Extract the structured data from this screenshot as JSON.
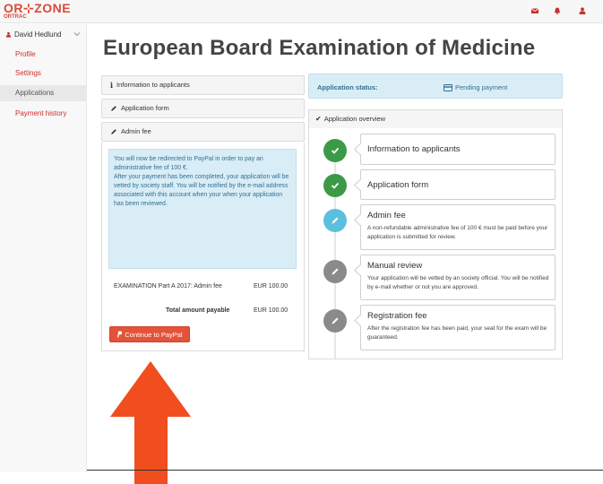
{
  "brand": {
    "logo_main": "OR⊹ZONE",
    "logo_sub": "ORTRAC"
  },
  "header_icons": [
    "envelope-icon",
    "bell-icon",
    "user-icon"
  ],
  "sidebar": {
    "user_name": "David Hedlund",
    "items": [
      {
        "label": "Profile",
        "active": false
      },
      {
        "label": "Settings",
        "active": false
      },
      {
        "label": "Applications",
        "active": true
      },
      {
        "label": "Payment history",
        "active": false
      }
    ]
  },
  "page_title": "European Board Examination of Medicine",
  "left_panel": {
    "sections": [
      {
        "label": "Information to applicants",
        "icon": "info-icon"
      },
      {
        "label": "Application form",
        "icon": "pencil-icon"
      },
      {
        "label": "Admin fee",
        "icon": "pencil-icon"
      }
    ],
    "info_text": [
      "You will now be redirected to PayPal in order to pay an administrative fee of 100 €.",
      "After your payment has been completed, your application will be vetted by society staff. You will be notified by the e-mail address associated with this account when your when your application has been reviewed."
    ],
    "fee_row": {
      "label": "EXAMINATION Part A 2017: Admin fee",
      "amount": "EUR 100.00"
    },
    "total_row": {
      "label": "Total amount payable",
      "amount": "EUR 100.00"
    },
    "paypal_button": "Continue to PayPal"
  },
  "right_panel": {
    "status_label": "Application status:",
    "status_value": "Pending payment",
    "overview_title": "Application overview",
    "steps": [
      {
        "title": "Information to applicants",
        "desc": "",
        "state": "done",
        "color": "#3c9a47"
      },
      {
        "title": "Application form",
        "desc": "",
        "state": "done",
        "color": "#3c9a47"
      },
      {
        "title": "Admin fee",
        "desc": "A non-refundable administrative fee of 100 € must be paid before your application is submitted for review.",
        "state": "current",
        "color": "#5bc0de"
      },
      {
        "title": "Manual review",
        "desc": "Your application will be vetted by an society official. You will be notified by e-mail whether or not you are approved.",
        "state": "pending",
        "color": "#8a8a8a"
      },
      {
        "title": "Registration fee",
        "desc": "After the registration fee has been paid, your seat for the exam will be guaranteed.",
        "state": "pending",
        "color": "#8a8a8a"
      }
    ]
  },
  "colors": {
    "brand": "#d94a38",
    "arrow": "#f04e1e",
    "done": "#3c9a47",
    "current": "#5bc0de",
    "pending": "#8a8a8a"
  }
}
